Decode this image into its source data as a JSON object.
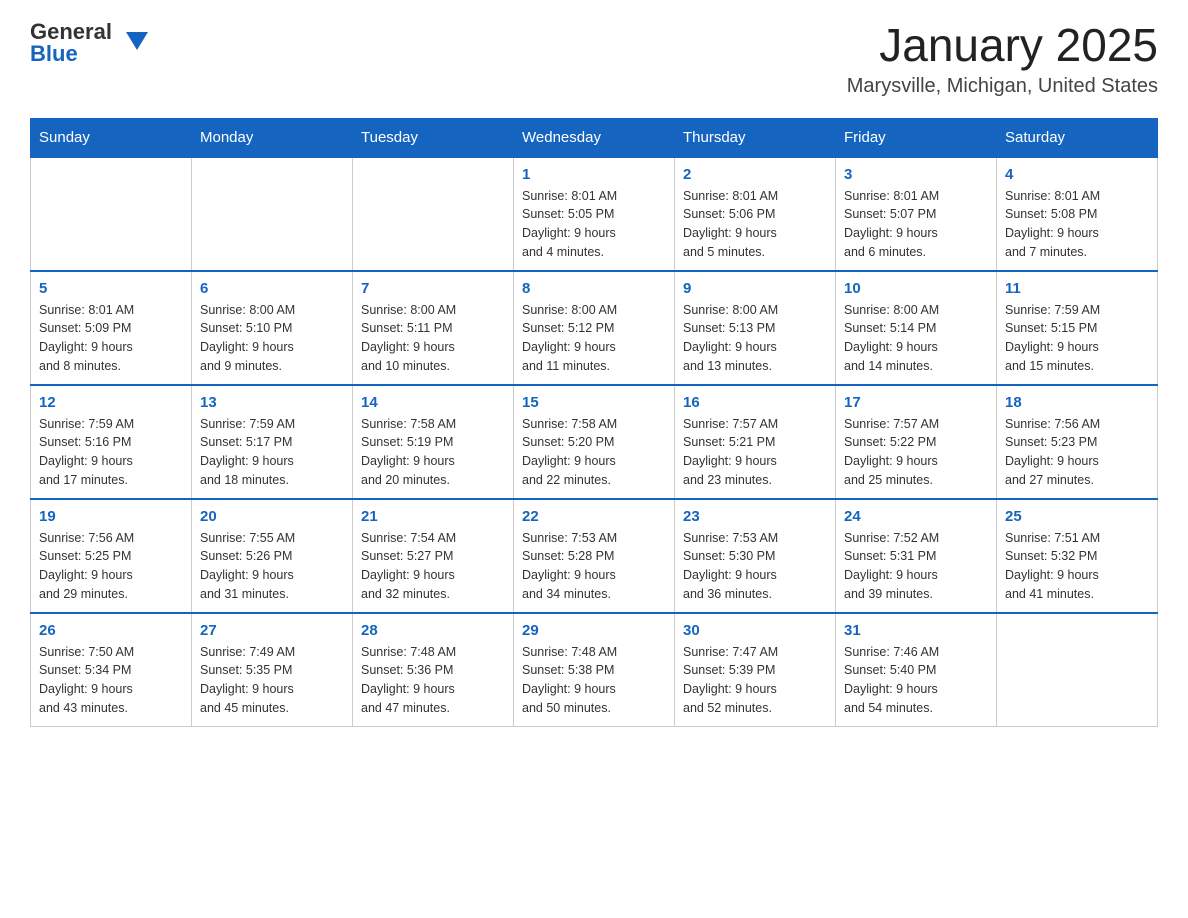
{
  "header": {
    "logo_general": "General",
    "logo_blue": "Blue",
    "month_title": "January 2025",
    "location": "Marysville, Michigan, United States"
  },
  "days_of_week": [
    "Sunday",
    "Monday",
    "Tuesday",
    "Wednesday",
    "Thursday",
    "Friday",
    "Saturday"
  ],
  "weeks": [
    [
      null,
      null,
      null,
      {
        "day": 1,
        "sunrise": "8:01 AM",
        "sunset": "5:05 PM",
        "daylight": "9 hours and 4 minutes."
      },
      {
        "day": 2,
        "sunrise": "8:01 AM",
        "sunset": "5:06 PM",
        "daylight": "9 hours and 5 minutes."
      },
      {
        "day": 3,
        "sunrise": "8:01 AM",
        "sunset": "5:07 PM",
        "daylight": "9 hours and 6 minutes."
      },
      {
        "day": 4,
        "sunrise": "8:01 AM",
        "sunset": "5:08 PM",
        "daylight": "9 hours and 7 minutes."
      }
    ],
    [
      {
        "day": 5,
        "sunrise": "8:01 AM",
        "sunset": "5:09 PM",
        "daylight": "9 hours and 8 minutes."
      },
      {
        "day": 6,
        "sunrise": "8:00 AM",
        "sunset": "5:10 PM",
        "daylight": "9 hours and 9 minutes."
      },
      {
        "day": 7,
        "sunrise": "8:00 AM",
        "sunset": "5:11 PM",
        "daylight": "9 hours and 10 minutes."
      },
      {
        "day": 8,
        "sunrise": "8:00 AM",
        "sunset": "5:12 PM",
        "daylight": "9 hours and 11 minutes."
      },
      {
        "day": 9,
        "sunrise": "8:00 AM",
        "sunset": "5:13 PM",
        "daylight": "9 hours and 13 minutes."
      },
      {
        "day": 10,
        "sunrise": "8:00 AM",
        "sunset": "5:14 PM",
        "daylight": "9 hours and 14 minutes."
      },
      {
        "day": 11,
        "sunrise": "7:59 AM",
        "sunset": "5:15 PM",
        "daylight": "9 hours and 15 minutes."
      }
    ],
    [
      {
        "day": 12,
        "sunrise": "7:59 AM",
        "sunset": "5:16 PM",
        "daylight": "9 hours and 17 minutes."
      },
      {
        "day": 13,
        "sunrise": "7:59 AM",
        "sunset": "5:17 PM",
        "daylight": "9 hours and 18 minutes."
      },
      {
        "day": 14,
        "sunrise": "7:58 AM",
        "sunset": "5:19 PM",
        "daylight": "9 hours and 20 minutes."
      },
      {
        "day": 15,
        "sunrise": "7:58 AM",
        "sunset": "5:20 PM",
        "daylight": "9 hours and 22 minutes."
      },
      {
        "day": 16,
        "sunrise": "7:57 AM",
        "sunset": "5:21 PM",
        "daylight": "9 hours and 23 minutes."
      },
      {
        "day": 17,
        "sunrise": "7:57 AM",
        "sunset": "5:22 PM",
        "daylight": "9 hours and 25 minutes."
      },
      {
        "day": 18,
        "sunrise": "7:56 AM",
        "sunset": "5:23 PM",
        "daylight": "9 hours and 27 minutes."
      }
    ],
    [
      {
        "day": 19,
        "sunrise": "7:56 AM",
        "sunset": "5:25 PM",
        "daylight": "9 hours and 29 minutes."
      },
      {
        "day": 20,
        "sunrise": "7:55 AM",
        "sunset": "5:26 PM",
        "daylight": "9 hours and 31 minutes."
      },
      {
        "day": 21,
        "sunrise": "7:54 AM",
        "sunset": "5:27 PM",
        "daylight": "9 hours and 32 minutes."
      },
      {
        "day": 22,
        "sunrise": "7:53 AM",
        "sunset": "5:28 PM",
        "daylight": "9 hours and 34 minutes."
      },
      {
        "day": 23,
        "sunrise": "7:53 AM",
        "sunset": "5:30 PM",
        "daylight": "9 hours and 36 minutes."
      },
      {
        "day": 24,
        "sunrise": "7:52 AM",
        "sunset": "5:31 PM",
        "daylight": "9 hours and 39 minutes."
      },
      {
        "day": 25,
        "sunrise": "7:51 AM",
        "sunset": "5:32 PM",
        "daylight": "9 hours and 41 minutes."
      }
    ],
    [
      {
        "day": 26,
        "sunrise": "7:50 AM",
        "sunset": "5:34 PM",
        "daylight": "9 hours and 43 minutes."
      },
      {
        "day": 27,
        "sunrise": "7:49 AM",
        "sunset": "5:35 PM",
        "daylight": "9 hours and 45 minutes."
      },
      {
        "day": 28,
        "sunrise": "7:48 AM",
        "sunset": "5:36 PM",
        "daylight": "9 hours and 47 minutes."
      },
      {
        "day": 29,
        "sunrise": "7:48 AM",
        "sunset": "5:38 PM",
        "daylight": "9 hours and 50 minutes."
      },
      {
        "day": 30,
        "sunrise": "7:47 AM",
        "sunset": "5:39 PM",
        "daylight": "9 hours and 52 minutes."
      },
      {
        "day": 31,
        "sunrise": "7:46 AM",
        "sunset": "5:40 PM",
        "daylight": "9 hours and 54 minutes."
      },
      null
    ]
  ],
  "labels": {
    "sunrise_label": "Sunrise:",
    "sunset_label": "Sunset:",
    "daylight_label": "Daylight:"
  }
}
